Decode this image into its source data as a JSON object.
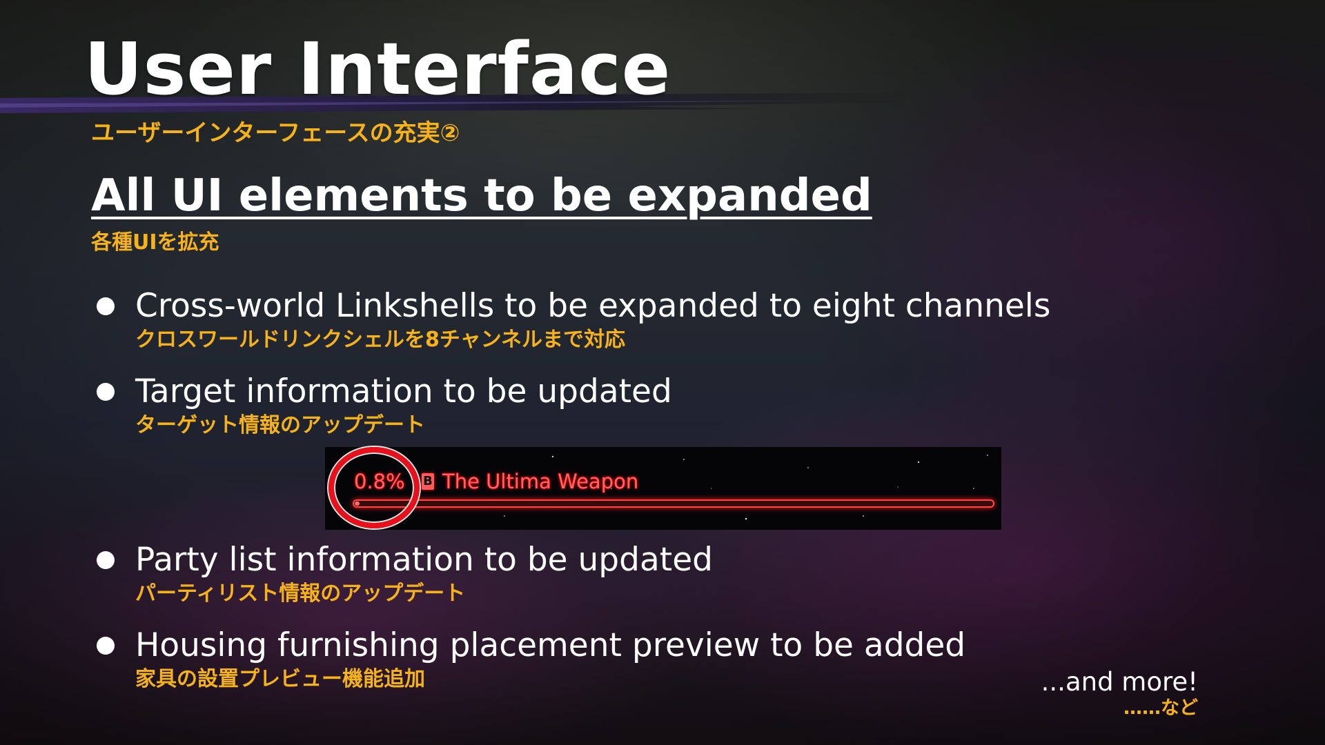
{
  "slide": {
    "title": "User Interface",
    "subtitle_jp": "ユーザーインターフェースの充実②",
    "section_heading": "All UI elements to be expanded",
    "section_heading_jp": "各種UIを拡充",
    "bullets": [
      {
        "text": "Cross-world Linkshells to be expanded to eight channels",
        "text_jp": "クロスワールドリンクシェルを8チャンネルまで対応"
      },
      {
        "text": "Target information to be updated",
        "text_jp": "ターゲット情報のアップデート"
      },
      {
        "text": "Party list information to be updated",
        "text_jp": "パーティリスト情報のアップデート"
      },
      {
        "text": "Housing furnishing placement preview to be added",
        "text_jp": "家具の設置プレビュー機能追加"
      }
    ],
    "more": "...and more!",
    "more_jp": "……など"
  },
  "target_bar": {
    "hp_percent": "0.8%",
    "hp_fraction": 0.008,
    "level_icon": "B",
    "target_name": "The Ultima Weapon"
  },
  "colors": {
    "accent_yellow": "#f6b21a",
    "text_white": "#ffffff",
    "target_red": "#ff6464",
    "highlight_circle": "#e8101a"
  }
}
